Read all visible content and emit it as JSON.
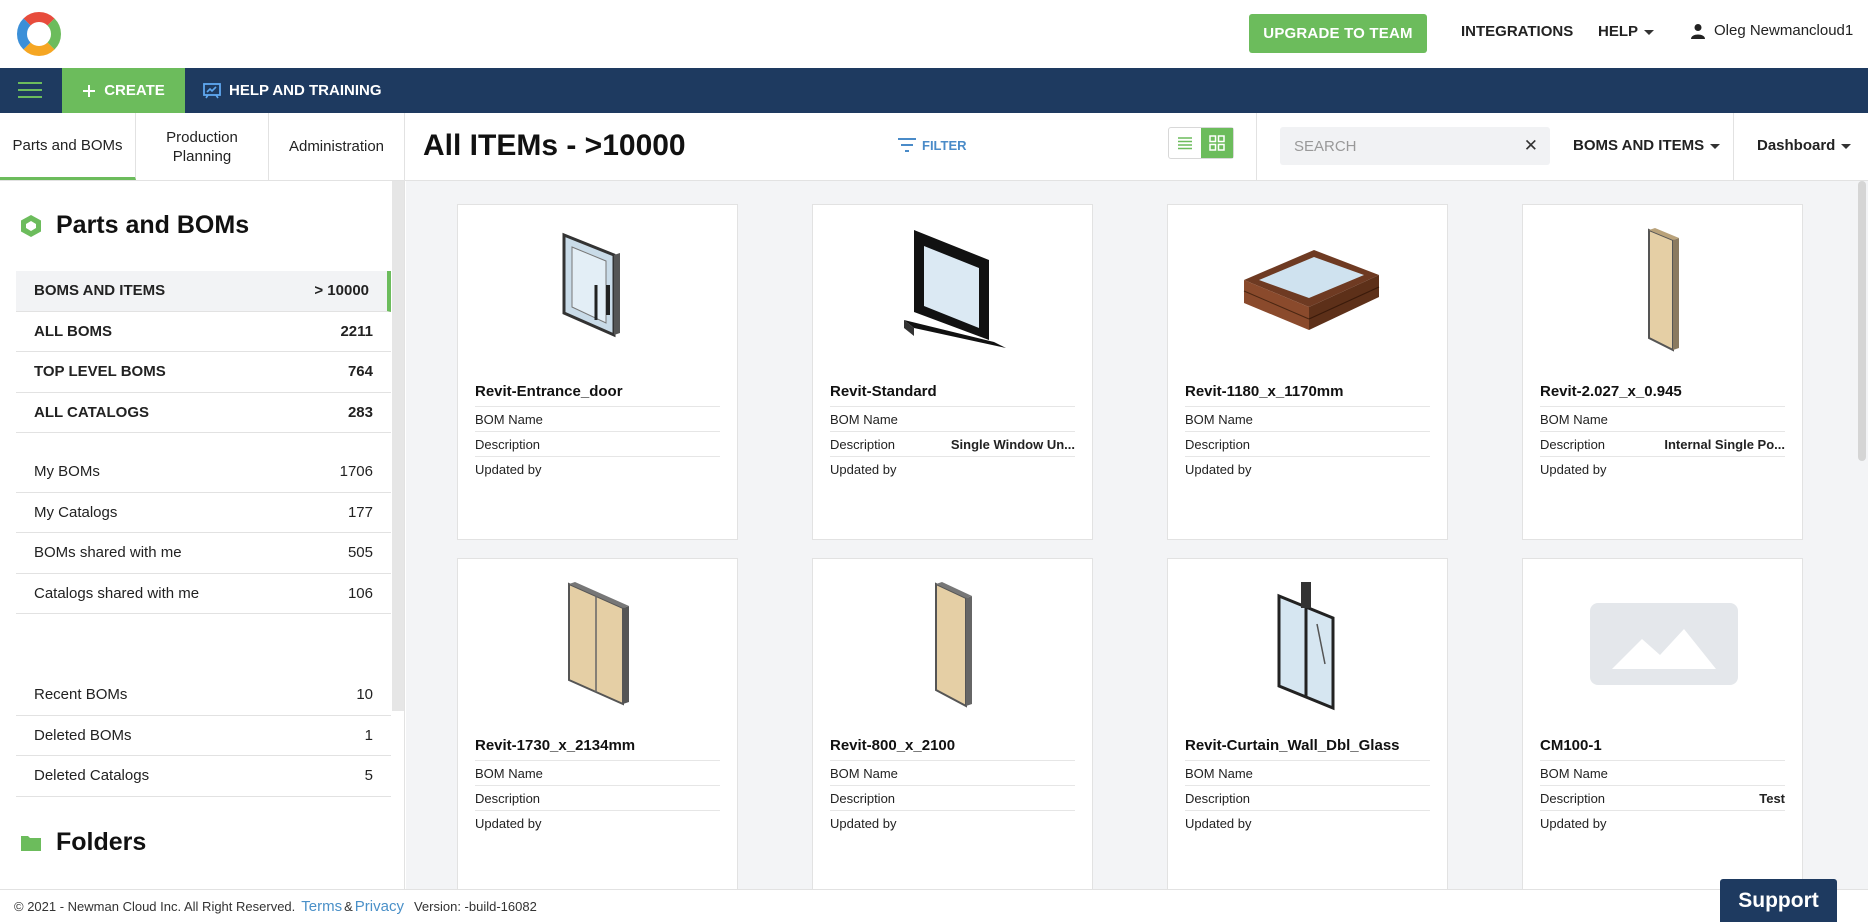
{
  "topbar": {
    "upgrade_label": "UPGRADE TO TEAM",
    "integrations_label": "INTEGRATIONS",
    "help_label": "HELP",
    "user_name": "Oleg Newmancloud1"
  },
  "navbar": {
    "create_label": "CREATE",
    "help_training_label": "HELP AND TRAINING"
  },
  "tabs": [
    {
      "label": "Parts and BOMs"
    },
    {
      "label": "Production Planning"
    },
    {
      "label": "Administration"
    }
  ],
  "header": {
    "title": "All ITEMs - >10000",
    "filter_label": "FILTER",
    "search_placeholder": "SEARCH",
    "scope_label": "BOMS AND ITEMS",
    "dashboard_label": "Dashboard"
  },
  "sidebar": {
    "title": "Parts and BOMs",
    "group1": [
      {
        "label": "BOMS AND ITEMS",
        "count": "> 10000"
      },
      {
        "label": "ALL BOMS",
        "count": "2211"
      },
      {
        "label": "TOP LEVEL BOMS",
        "count": "764"
      },
      {
        "label": "ALL CATALOGS",
        "count": "283"
      }
    ],
    "group2": [
      {
        "label": "My BOMs",
        "count": "1706"
      },
      {
        "label": "My Catalogs",
        "count": "177"
      },
      {
        "label": "BOMs shared with me",
        "count": "505"
      },
      {
        "label": "Catalogs shared with me",
        "count": "106"
      }
    ],
    "group3": [
      {
        "label": "Recent BOMs",
        "count": "10"
      },
      {
        "label": "Deleted BOMs",
        "count": "1"
      },
      {
        "label": "Deleted Catalogs",
        "count": "5"
      }
    ],
    "folders_title": "Folders"
  },
  "card_fields": {
    "bom_name": "BOM Name",
    "description": "Description",
    "updated_by": "Updated by"
  },
  "cards": [
    {
      "name": "Revit-Entrance_door",
      "description": "",
      "icon": "entrance-door-thumbnail"
    },
    {
      "name": "Revit-Standard",
      "description": "Single Window Un...",
      "icon": "standard-window-thumbnail"
    },
    {
      "name": "Revit-1180_x_1170mm",
      "description": "",
      "icon": "skylight-thumbnail"
    },
    {
      "name": "Revit-2.027_x_0.945",
      "description": "Internal Single Po...",
      "icon": "single-door-thumbnail"
    },
    {
      "name": "Revit-1730_x_2134mm",
      "description": "",
      "icon": "double-door-thumbnail"
    },
    {
      "name": "Revit-800_x_2100",
      "description": "",
      "icon": "narrow-door-thumbnail"
    },
    {
      "name": "Revit-Curtain_Wall_Dbl_Glass",
      "description": "",
      "icon": "curtain-wall-thumbnail"
    },
    {
      "name": "CM100-1",
      "description": "Test",
      "icon": "image-placeholder-icon"
    }
  ],
  "footer": {
    "copyright": "© 2021 - Newman Cloud Inc. All Right Reserved.",
    "terms": "Terms",
    "amp": "&",
    "privacy": "Privacy",
    "version": "Version: -build-16082"
  },
  "support_label": "Support",
  "colors": {
    "accent_green": "#6cbc5c",
    "navy": "#1e3a60",
    "link_blue": "#4a90c8"
  }
}
